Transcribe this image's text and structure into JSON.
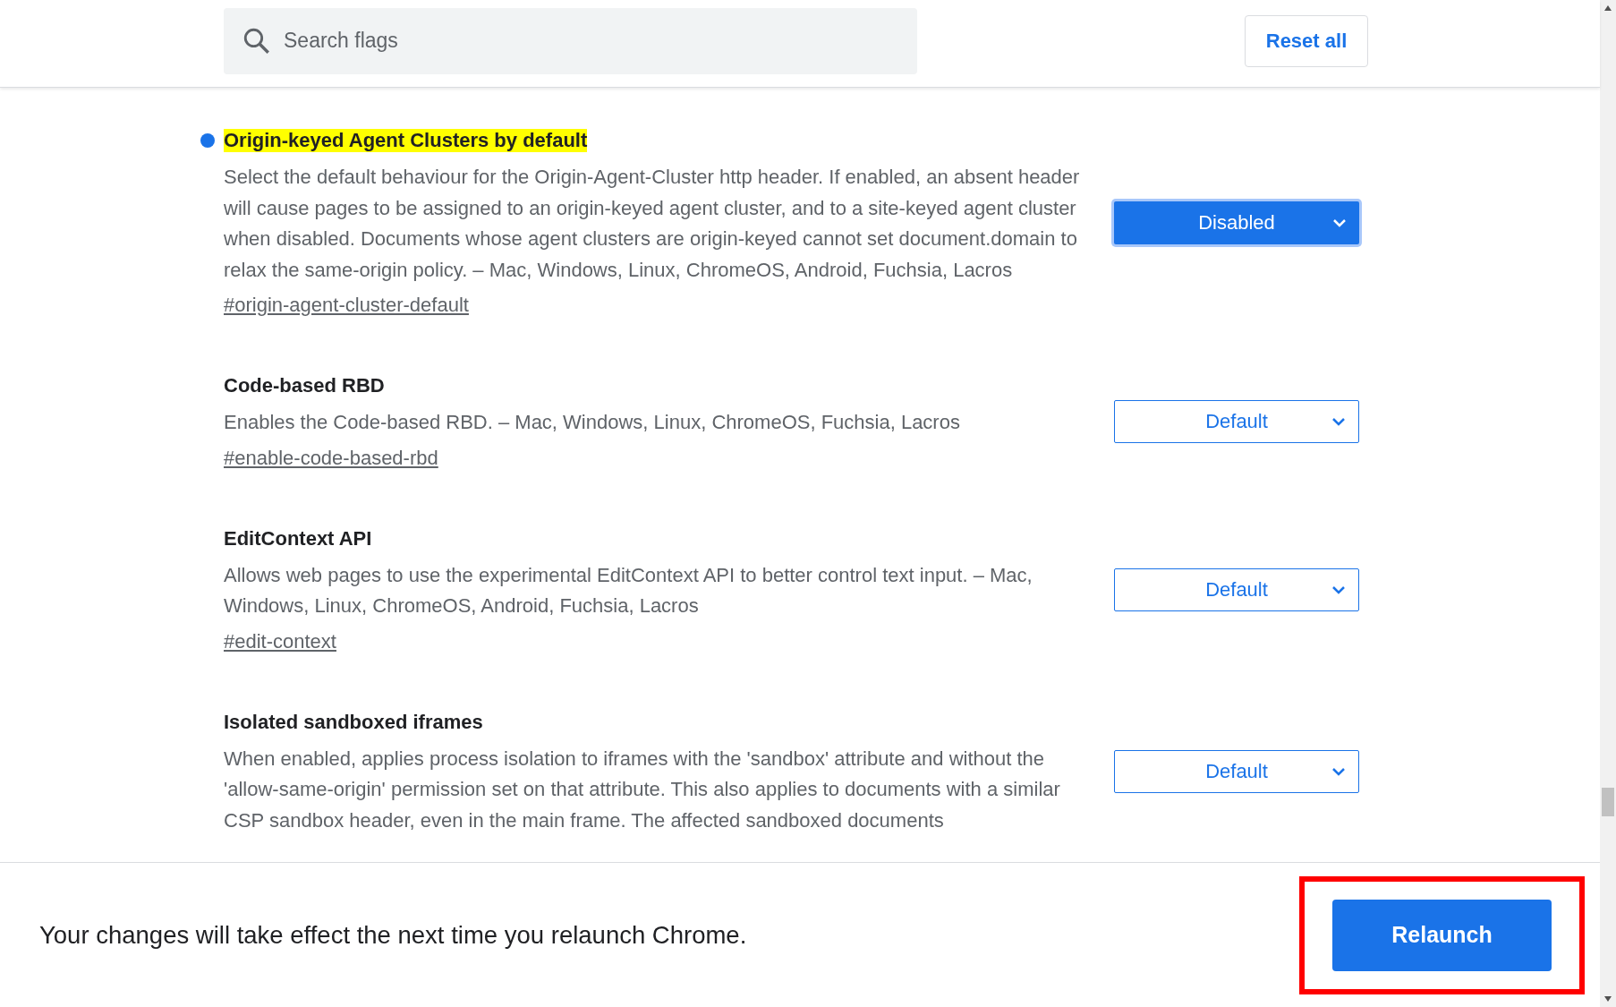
{
  "search": {
    "placeholder": "Search flags"
  },
  "reset_button": "Reset all",
  "flags": [
    {
      "title": "Origin-keyed Agent Clusters by default",
      "highlighted": true,
      "modified": true,
      "description": "Select the default behaviour for the Origin-Agent-Cluster http header. If enabled, an absent header will cause pages to be assigned to an origin-keyed agent cluster, and to a site-keyed agent cluster when disabled. Documents whose agent clusters are origin-keyed cannot set document.domain to relax the same-origin policy. – Mac, Windows, Linux, ChromeOS, Android, Fuchsia, Lacros",
      "link": "#origin-agent-cluster-default",
      "value": "Disabled"
    },
    {
      "title": "Code-based RBD",
      "highlighted": false,
      "modified": false,
      "description": "Enables the Code-based RBD. – Mac, Windows, Linux, ChromeOS, Fuchsia, Lacros",
      "link": "#enable-code-based-rbd",
      "value": "Default"
    },
    {
      "title": "EditContext API",
      "highlighted": false,
      "modified": false,
      "description": "Allows web pages to use the experimental EditContext API to better control text input. – Mac, Windows, Linux, ChromeOS, Android, Fuchsia, Lacros",
      "link": "#edit-context",
      "value": "Default"
    },
    {
      "title": "Isolated sandboxed iframes",
      "highlighted": false,
      "modified": false,
      "description": "When enabled, applies process isolation to iframes with the 'sandbox' attribute and without the 'allow-same-origin' permission set on that attribute. This also applies to documents with a similar CSP sandbox header, even in the main frame. The affected sandboxed documents",
      "value": "Default"
    }
  ],
  "footer": {
    "message": "Your changes will take effect the next time you relaunch Chrome.",
    "button": "Relaunch"
  }
}
